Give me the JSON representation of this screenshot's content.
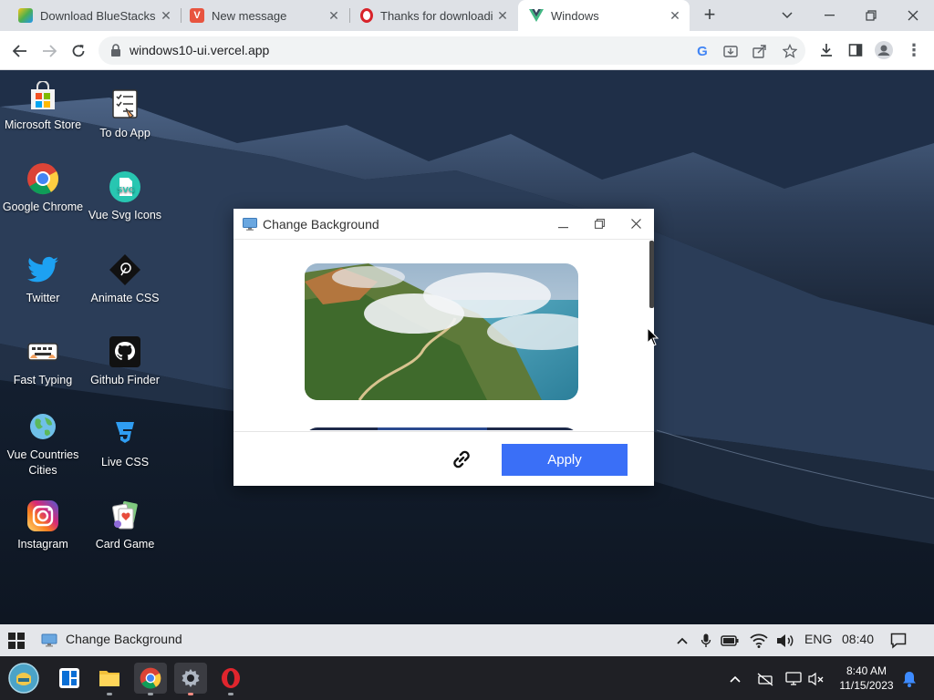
{
  "browser": {
    "tabs": [
      {
        "title": "Download BlueStacks",
        "active": false
      },
      {
        "title": "New message",
        "active": false
      },
      {
        "title": "Thanks for downloadi",
        "active": false
      },
      {
        "title": "Windows",
        "active": true
      }
    ],
    "url": "windows10-ui.vercel.app"
  },
  "desktop_icons": [
    {
      "label": "Microsoft Store",
      "icon": "microsoft-store-icon"
    },
    {
      "label": "To do App",
      "icon": "todo-app-icon"
    },
    {
      "label": "Google Chrome",
      "icon": "chrome-icon"
    },
    {
      "label": "Vue Svg Icons",
      "icon": "svg-icon"
    },
    {
      "label": "Twitter",
      "icon": "twitter-icon"
    },
    {
      "label": "Animate CSS",
      "icon": "animate-css-icon"
    },
    {
      "label": "Fast Typing",
      "icon": "keyboard-icon"
    },
    {
      "label": "Github Finder",
      "icon": "github-icon"
    },
    {
      "label": "Vue Countries Cities",
      "icon": "globe-icon"
    },
    {
      "label": "Live CSS",
      "icon": "css3-icon"
    },
    {
      "label": "Instagram",
      "icon": "instagram-icon"
    },
    {
      "label": "Card Game",
      "icon": "card-game-icon"
    }
  ],
  "dialog": {
    "title": "Change Background",
    "apply_label": "Apply"
  },
  "web_taskbar": {
    "open_app": "Change Background",
    "language": "ENG",
    "time": "08:40"
  },
  "os_taskbar": {
    "time": "8:40 AM",
    "date": "11/15/2023"
  },
  "colors": {
    "apply_button": "#3a6ff7",
    "tabstrip": "#dee1e6",
    "os_taskbar": "#1f2025"
  }
}
